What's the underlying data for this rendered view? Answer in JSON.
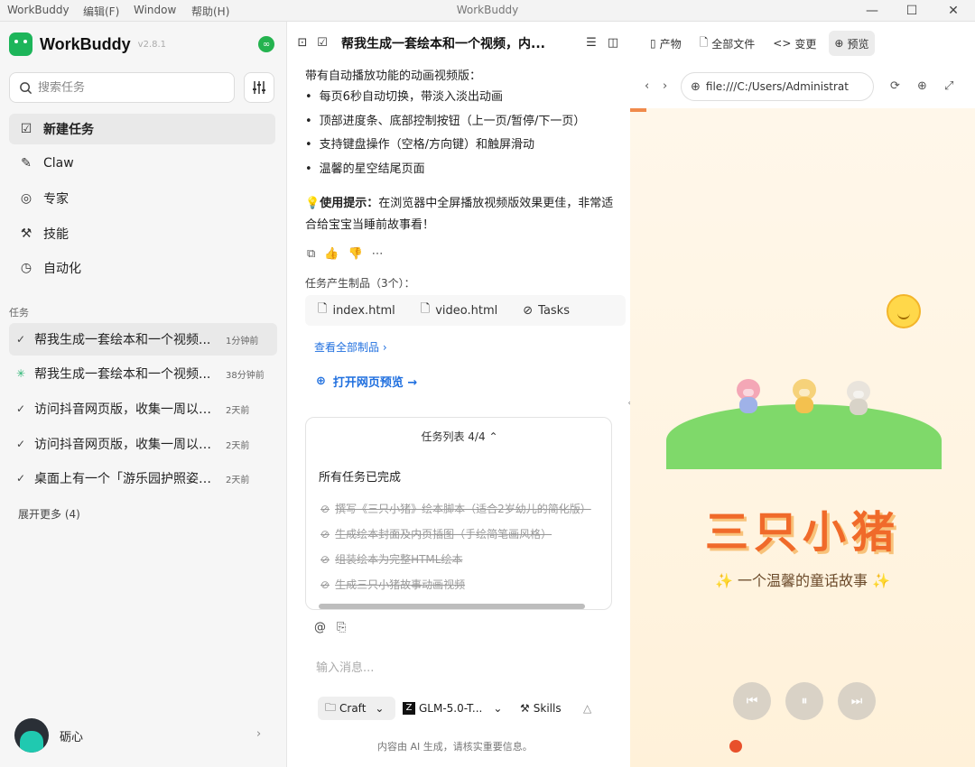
{
  "titlebar": {
    "menus": [
      "WorkBuddy",
      "编辑(F)",
      "Window",
      "帮助(H)"
    ],
    "title": "WorkBuddy"
  },
  "sidebar": {
    "brand": "WorkBuddy",
    "version": "v2.8.1",
    "search_placeholder": "搜索任务",
    "nav": [
      {
        "label": "新建任务",
        "icon": "new-task-icon"
      },
      {
        "label": "Claw",
        "icon": "claw-icon"
      },
      {
        "label": "专家",
        "icon": "expert-icon"
      },
      {
        "label": "技能",
        "icon": "skills-icon"
      },
      {
        "label": "自动化",
        "icon": "clock-icon"
      }
    ],
    "tasks_label": "任务",
    "tasks": [
      {
        "title": "帮我生成一套绘本和一个视频...",
        "time": "1分钟前"
      },
      {
        "title": "帮我生成一套绘本和一个视频...",
        "time": "38分钟前"
      },
      {
        "title": "访问抖音网页版，收集一周以内...",
        "time": "2天前"
      },
      {
        "title": "访问抖音网页版，收集一周以内...",
        "time": "2天前"
      },
      {
        "title": "桌面上有一个「游乐园护照姿势...",
        "time": "2天前"
      }
    ],
    "expand_more": "展开更多 (4)",
    "user_name": "砺心"
  },
  "chat": {
    "title": "帮我生成一套绘本和一个视频，内...",
    "intro": "带有自动播放功能的动画视频版：",
    "bullets": [
      "每页6秒自动切换，带淡入淡出动画",
      "顶部进度条、底部控制按钮（上一页/暂停/下一页）",
      "支持键盘操作（空格/方向键）和触屏滑动",
      "温馨的星空结尾页面"
    ],
    "tip_label": "使用提示：",
    "tip_text": "在浏览器中全屏播放视频版效果更佳，非常适合给宝宝当睡前故事看！",
    "artifacts_label": "任务产生制品（3个）：",
    "artifacts": [
      "index.html",
      "video.html",
      "Tasks"
    ],
    "see_all": "查看全部制品",
    "open_preview": "打开网页预览 →",
    "task_panel": {
      "header": "任务列表 4/4",
      "status": "所有任务已完成",
      "items": [
        "撰写《三只小猪》绘本脚本（适合2岁幼儿的简化版）",
        "生成绘本封面及内页插图（手绘简笔画风格）",
        "组装绘本为完整HTML绘本",
        "生成三只小猪故事动画视频"
      ]
    },
    "input_placeholder": "输入消息...",
    "mode": "Craft",
    "model": "GLM-5.0-T...",
    "skills": "Skills",
    "footnote": "内容由 AI 生成，请核实重要信息。"
  },
  "preview": {
    "tabs": [
      "产物",
      "全部文件",
      "变更",
      "预览"
    ],
    "url": "file:///C:/Users/Administrat",
    "story_title": "三只小猪",
    "story_subtitle": "✨ 一个温馨的童话故事 ✨"
  }
}
